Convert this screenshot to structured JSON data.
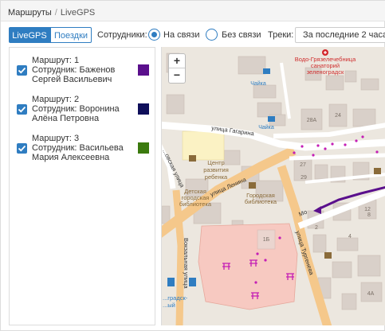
{
  "breadcrumb": {
    "root": "Маршруты",
    "separator": "/",
    "current": "LiveGPS"
  },
  "tabs": {
    "active": "LiveGPS",
    "inactive": "Поездки"
  },
  "filters": {
    "employees_label": "Сотрудники:",
    "online_label": "На связи",
    "offline_label": "Без связи",
    "tracks_label": "Треки:",
    "tracks_value": "За последние 2 часа"
  },
  "routes": [
    {
      "line1": "Маршрут: 1",
      "line2": "Сотрудник: Баженов",
      "line3": "Сергей Васильевич",
      "color": "#5a0f8c"
    },
    {
      "line1": "Маршрут: 2",
      "line2": "Сотрудник: Воронина",
      "line3": "Алёна Петровна",
      "color": "#0f0f5a"
    },
    {
      "line1": "Маршрут: 3",
      "line2": "Сотрудник: Васильева",
      "line3": "Мария Алексеевна",
      "color": "#3b7a0e"
    }
  ],
  "map": {
    "zoom_in": "+",
    "zoom_out": "−",
    "poi_hospital": "Водо-Грязелечебница",
    "poi_sanatorium": "санаторий",
    "poi_zelenograd": "зеленоградск",
    "poi_chaika1": "Чайка",
    "poi_chaika2": "Чайка",
    "street_gagarina": "улица Гагарина",
    "street_lenina": "улица Ленина",
    "street_turgeneva": "улица Тургенева",
    "street_vokzalnaya": "Вокзальная улица",
    "street_left": "...овская улица",
    "street_mo": "Мо",
    "center_line1": "Центр",
    "center_line2": "развития",
    "center_line3": "ребенка",
    "lib1_line1": "Детская",
    "lib1_line2": "городская",
    "lib1_line3": "библиотека",
    "lib2_line1": "Городская",
    "lib2_line2": "библиотека",
    "station_line1": "...градск-",
    "station_line2": "...ый",
    "house_28a": "28А",
    "house_24": "24",
    "house_27": "27",
    "house_29": "29",
    "house_12": "12",
    "house_8": "8",
    "house_4": "4",
    "house_2": "2",
    "house_1b": "1Б",
    "house_4a": "4А",
    "accent": "#2f7dc1",
    "track_color": "#5a0f8c",
    "marker_color": "#c41eb5"
  }
}
